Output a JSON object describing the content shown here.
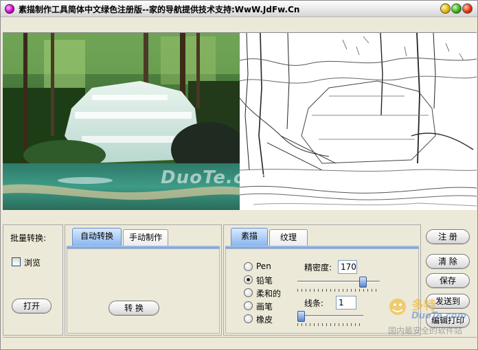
{
  "window": {
    "title": "素描制作工具简体中文绿色注册版--家的导航提供技术支持:WwW.JdFw.Cn"
  },
  "preview": {
    "watermark": "DuoTe.com"
  },
  "batch": {
    "label": "批量转换:",
    "browse_label": "浏览",
    "browse_checked": false,
    "open_button": "打开"
  },
  "mode_tabs": {
    "tabs": [
      "自动转换",
      "手动制作"
    ],
    "active": "自动转换",
    "convert_button": "转  换"
  },
  "style_tabs": {
    "tabs": [
      "素描",
      "纹理"
    ],
    "active": "素描",
    "tools": [
      "Pen",
      "铅笔",
      "柔和的",
      "画笔",
      "橡皮"
    ],
    "selected_tool": "铅笔",
    "density_label": "精密度:",
    "density_value": "170",
    "stroke_label": "线条:",
    "stroke_value": "1"
  },
  "actions": {
    "register": "注 册",
    "clear": "清 除",
    "save": "保存",
    "send_to": "发送到",
    "edit_print": "编辑打印"
  },
  "overlay_logo": {
    "brand": "多特",
    "site": "DuoTe.com",
    "slogan": "国内最安全的软件站"
  },
  "colors": {
    "active_tab": "#8ab6ee",
    "window_bg": "#ece9d8"
  }
}
